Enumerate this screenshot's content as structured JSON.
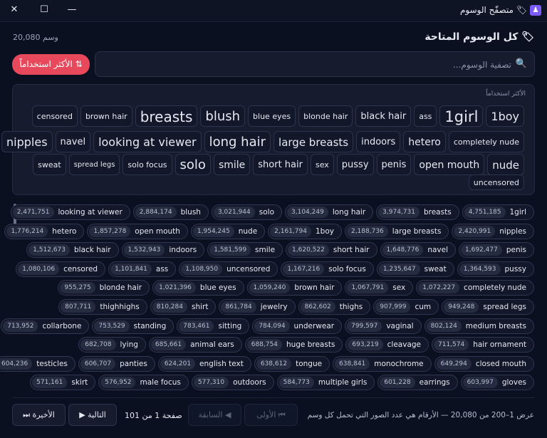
{
  "window": {
    "title": "متصفّح الوسوم",
    "minimize_label": "—",
    "maximize_label": "☐",
    "close_label": "✕",
    "app_icon": "tag-app-icon"
  },
  "header": {
    "title": "كل الوسوم المتاحة",
    "title_icon": "tag-icon",
    "count": "20,080 وسم"
  },
  "search": {
    "placeholder": "تصفية الوسوم...",
    "value": ""
  },
  "sort_button": {
    "label": "⇅ الأكثر استخداماً",
    "color": "#e8485c"
  },
  "cloud": {
    "heading": "الأكثر استخداماً",
    "rows": [
      [
        {
          "name": "1boy",
          "size": 16
        },
        {
          "name": "1girl",
          "size": 21
        },
        {
          "name": "ass",
          "size": 11
        },
        {
          "name": "black hair",
          "size": 13
        },
        {
          "name": "blonde hair",
          "size": 11
        },
        {
          "name": "blue eyes",
          "size": 11
        },
        {
          "name": "blush",
          "size": 18
        },
        {
          "name": "breasts",
          "size": 20
        },
        {
          "name": "brown hair",
          "size": 11
        },
        {
          "name": "censored",
          "size": 11
        }
      ],
      [
        {
          "name": "completely nude",
          "size": 11
        },
        {
          "name": "hetero",
          "size": 14
        },
        {
          "name": "indoors",
          "size": 13
        },
        {
          "name": "large breasts",
          "size": 15
        },
        {
          "name": "long hair",
          "size": 18
        },
        {
          "name": "looking at viewer",
          "size": 16
        },
        {
          "name": "navel",
          "size": 13
        },
        {
          "name": "nipples",
          "size": 16
        }
      ],
      [
        {
          "name": "nude",
          "size": 15
        },
        {
          "name": "open mouth",
          "size": 14
        },
        {
          "name": "penis",
          "size": 13
        },
        {
          "name": "pussy",
          "size": 13
        },
        {
          "name": "sex",
          "size": 11
        },
        {
          "name": "short hair",
          "size": 13
        },
        {
          "name": "smile",
          "size": 14
        },
        {
          "name": "solo",
          "size": 18
        },
        {
          "name": "solo focus",
          "size": 11
        },
        {
          "name": "spread legs",
          "size": 10
        },
        {
          "name": "sweat",
          "size": 11
        }
      ],
      [
        {
          "name": "uncensored",
          "size": 11
        }
      ]
    ]
  },
  "tag_list": {
    "rows": [
      [
        {
          "name": "1girl",
          "count": "4,751,185"
        },
        {
          "name": "breasts",
          "count": "3,974,731"
        },
        {
          "name": "long hair",
          "count": "3,104,249"
        },
        {
          "name": "solo",
          "count": "3,021,944"
        },
        {
          "name": "blush",
          "count": "2,884,174"
        },
        {
          "name": "looking at viewer",
          "count": "2,471,751"
        }
      ],
      [
        {
          "name": "nipples",
          "count": "2,420,991"
        },
        {
          "name": "large breasts",
          "count": "2,188,736"
        },
        {
          "name": "1boy",
          "count": "2,161,794"
        },
        {
          "name": "nude",
          "count": "1,954,245"
        },
        {
          "name": "open mouth",
          "count": "1,857,278"
        },
        {
          "name": "hetero",
          "count": "1,776,214"
        }
      ],
      [
        {
          "name": "penis",
          "count": "1,692,477"
        },
        {
          "name": "navel",
          "count": "1,648,776"
        },
        {
          "name": "short hair",
          "count": "1,620,522"
        },
        {
          "name": "smile",
          "count": "1,581,599"
        },
        {
          "name": "indoors",
          "count": "1,532,943"
        },
        {
          "name": "black hair",
          "count": "1,512,673"
        }
      ],
      [
        {
          "name": "pussy",
          "count": "1,364,593"
        },
        {
          "name": "sweat",
          "count": "1,235,647"
        },
        {
          "name": "solo focus",
          "count": "1,167,216"
        },
        {
          "name": "uncensored",
          "count": "1,108,950"
        },
        {
          "name": "ass",
          "count": "1,101,841"
        },
        {
          "name": "censored",
          "count": "1,080,106"
        }
      ],
      [
        {
          "name": "completely nude",
          "count": "1,072,227"
        },
        {
          "name": "sex",
          "count": "1,067,791"
        },
        {
          "name": "brown hair",
          "count": "1,059,240"
        },
        {
          "name": "blue eyes",
          "count": "1,021,396"
        },
        {
          "name": "blonde hair",
          "count": "955,275"
        }
      ],
      [
        {
          "name": "spread legs",
          "count": "949,248"
        },
        {
          "name": "cum",
          "count": "907,999"
        },
        {
          "name": "thighs",
          "count": "862,602"
        },
        {
          "name": "jewelry",
          "count": "861,784"
        },
        {
          "name": "shirt",
          "count": "810,284"
        },
        {
          "name": "thighhighs",
          "count": "807,711"
        }
      ],
      [
        {
          "name": "medium breasts",
          "count": "802,124"
        },
        {
          "name": "vaginal",
          "count": "799,597"
        },
        {
          "name": "underwear",
          "count": "784,094"
        },
        {
          "name": "sitting",
          "count": "783,461"
        },
        {
          "name": "standing",
          "count": "753,529"
        },
        {
          "name": "collarbone",
          "count": "713,952"
        }
      ],
      [
        {
          "name": "hair ornament",
          "count": "711,574"
        },
        {
          "name": "cleavage",
          "count": "693,219"
        },
        {
          "name": "huge breasts",
          "count": "688,754"
        },
        {
          "name": "animal ears",
          "count": "685,661"
        },
        {
          "name": "lying",
          "count": "682,708"
        }
      ],
      [
        {
          "name": "closed mouth",
          "count": "649,294"
        },
        {
          "name": "monochrome",
          "count": "638,841"
        },
        {
          "name": "tongue",
          "count": "638,612"
        },
        {
          "name": "english text",
          "count": "624,201"
        },
        {
          "name": "panties",
          "count": "606,707"
        },
        {
          "name": "testicles",
          "count": "604,236"
        }
      ],
      [
        {
          "name": "gloves",
          "count": "603,997"
        },
        {
          "name": "earrings",
          "count": "601,228"
        },
        {
          "name": "multiple girls",
          "count": "584,773"
        },
        {
          "name": "outdoors",
          "count": "577,310"
        },
        {
          "name": "male focus",
          "count": "576,952"
        },
        {
          "name": "skirt",
          "count": "571,161"
        }
      ]
    ]
  },
  "footer": {
    "summary": "عرض 1–200 من 20,080 — الأرقام هي عدد الصور التي تحمل كل وسم",
    "first_label": "⏮ الأولى",
    "prev_label": "◀ السابقة",
    "page_indicator": "صفحة 1 من 101",
    "next_label": "التالية ▶",
    "last_label": "الأخيرة ⏭"
  }
}
